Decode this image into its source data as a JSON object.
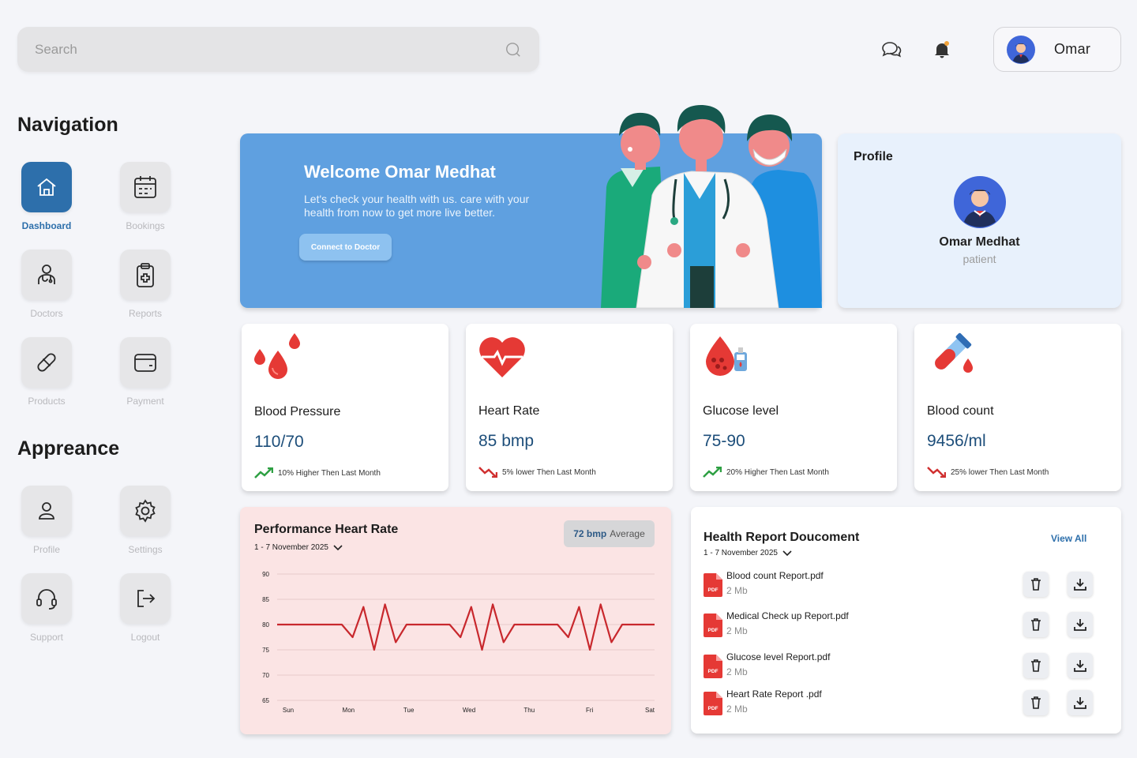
{
  "search": {
    "placeholder": "Search"
  },
  "header": {
    "user_name": "Omar"
  },
  "sidebar": {
    "navigation_title": "Navigation",
    "appearance_title": "Appreance",
    "nav_items": [
      {
        "label": "Dashboard",
        "icon": "home-icon"
      },
      {
        "label": "Bookings",
        "icon": "calendar-icon"
      },
      {
        "label": "Doctors",
        "icon": "doctor-icon"
      },
      {
        "label": "Reports",
        "icon": "clipboard-icon"
      },
      {
        "label": "Products",
        "icon": "pill-icon"
      },
      {
        "label": "Payment",
        "icon": "wallet-icon"
      }
    ],
    "appearance_items": [
      {
        "label": "Profile",
        "icon": "user-icon"
      },
      {
        "label": "Settings",
        "icon": "gear-icon"
      },
      {
        "label": "Support",
        "icon": "headset-icon"
      },
      {
        "label": "Logout",
        "icon": "logout-icon"
      }
    ]
  },
  "welcome": {
    "title": "Welcome Omar Medhat",
    "message": "Let's check your health with us. care with your health from now to get more live better.",
    "button": "Connect to Doctor"
  },
  "profile": {
    "title": "Profile",
    "name": "Omar Medhat",
    "role": "patient"
  },
  "metrics": [
    {
      "name": "Blood Pressure",
      "value": "110/70",
      "trend": "10% Higher Then Last Month",
      "direction": "up"
    },
    {
      "name": "Heart Rate",
      "value": "85 bmp",
      "trend": "5% lower Then Last Month",
      "direction": "down"
    },
    {
      "name": "Glucose level",
      "value": "75-90",
      "trend": "20% Higher Then Last Month",
      "direction": "up"
    },
    {
      "name": "Blood count",
      "value": "9456/ml",
      "trend": "25% lower Then Last Month",
      "direction": "down"
    }
  ],
  "performance": {
    "title": "Performance Heart Rate",
    "date_range": "1 - 7 November 2025",
    "average_value": "72 bmp",
    "average_label": "Average"
  },
  "reports": {
    "title": "Health Report Doucoment",
    "date_range": "1 - 7 November 2025",
    "view_all": "View All",
    "pdf_badge": "PDF",
    "files": [
      {
        "name": "Blood count Report.pdf",
        "size": "2 Mb"
      },
      {
        "name": "Medical Check up Report.pdf",
        "size": "2 Mb"
      },
      {
        "name": "Glucose level Report.pdf",
        "size": "2 Mb"
      },
      {
        "name": "Heart Rate Report .pdf",
        "size": "2 Mb"
      }
    ]
  },
  "colors": {
    "primary": "#2d6fab",
    "banner": "#5fa0e0",
    "heart_line": "#c8282d",
    "trend_up": "#2ea043",
    "trend_down": "#d03030"
  },
  "chart_data": {
    "type": "line",
    "title": "Performance Heart Rate",
    "categories": [
      "Sun",
      "Mon",
      "Tue",
      "Wed",
      "Thu",
      "Fri",
      "Sat"
    ],
    "y_ticks": [
      90,
      85,
      80,
      75,
      70,
      65
    ],
    "ylim": [
      65,
      90
    ],
    "baseline": 80,
    "series": [
      {
        "values": [
          80,
          80,
          80,
          80,
          80,
          80,
          80,
          77.5,
          83.5,
          75,
          84,
          76.5,
          80,
          80,
          80,
          80,
          80,
          77.5,
          83.5,
          75,
          84,
          76.5,
          80,
          80,
          80,
          80,
          80,
          77.5,
          83.5,
          75,
          84,
          76.5,
          80,
          80,
          80,
          80
        ]
      }
    ],
    "grid": true,
    "legend": "none"
  }
}
